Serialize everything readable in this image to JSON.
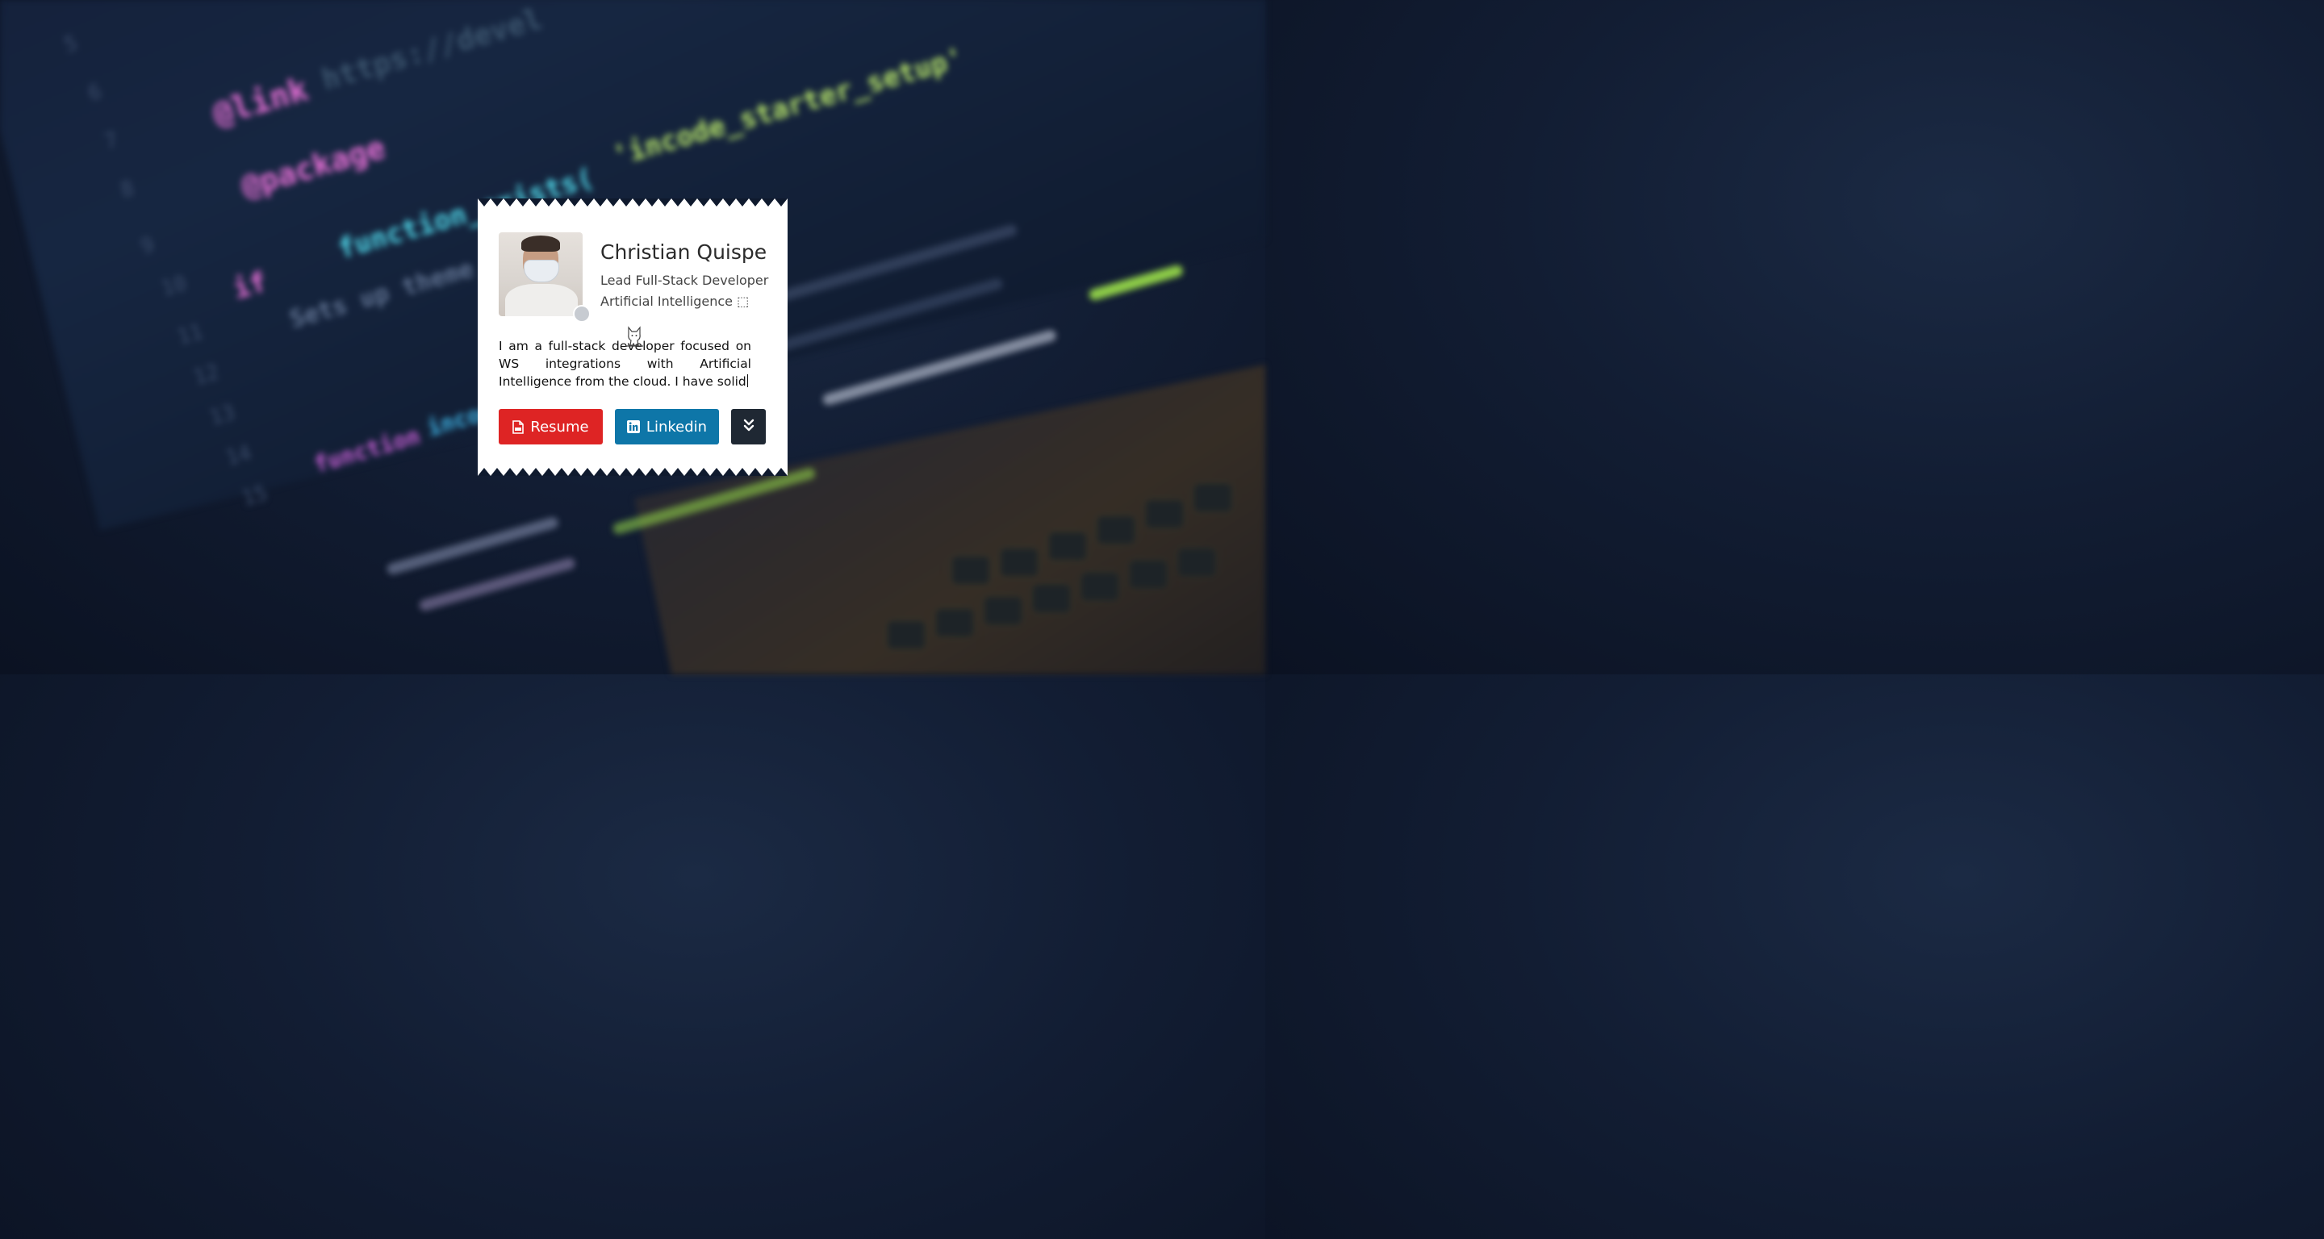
{
  "profile": {
    "name": "Christian Quispe",
    "role_line1": "Lead Full-Stack Developer",
    "role_line2": "Artificial Intelligence ⬚",
    "bio": "I am a full-stack developer focused on WS integrations with Artificial Intelligence from the cloud. I have solid",
    "status": "offline"
  },
  "buttons": {
    "resume_label": "Resume",
    "linkedin_label": "Linkedin"
  },
  "icons": {
    "resume": "file-pdf-icon",
    "linkedin": "linkedin-icon",
    "more": "double-chevron-down-icon",
    "cat": "cat-icon"
  },
  "colors": {
    "resume": "#de2424",
    "linkedin": "#0e76a8",
    "more": "#1f2833",
    "status_dot": "#c7cbd1",
    "card": "#ffffff"
  }
}
